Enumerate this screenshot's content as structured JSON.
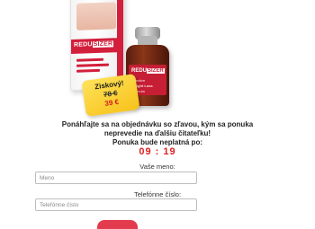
{
  "product": {
    "box_brand_prefix": "REDU",
    "box_brand_suffix": "SIZER",
    "bottle_brand_prefix": "REDU",
    "bottle_brand_suffix": "SIZER",
    "bottle_line1": "Effective",
    "bottle_line2": "Weight Loss",
    "bottle_line3": "Formula"
  },
  "sticker": {
    "title": "Ziskový!",
    "old_price": "78 €",
    "new_price": "39 €"
  },
  "promo": {
    "line1": "Ponáhľajte sa na objednávku so zľavou, kým sa ponuka",
    "line2": "neprevedie na ďalšiu čitateľku!",
    "line3": "Ponuka bude neplatná po:",
    "timer": "09 : 19"
  },
  "form": {
    "name_label": "Vaše meno:",
    "name_placeholder": "Meno",
    "phone_label": "Telefónne číslo:",
    "phone_placeholder": "Telefónne číslo"
  },
  "colors": {
    "accent": "#d21f3c",
    "timer": "#e02020",
    "sticker": "#f6c21a",
    "button": "#e23b4e"
  }
}
